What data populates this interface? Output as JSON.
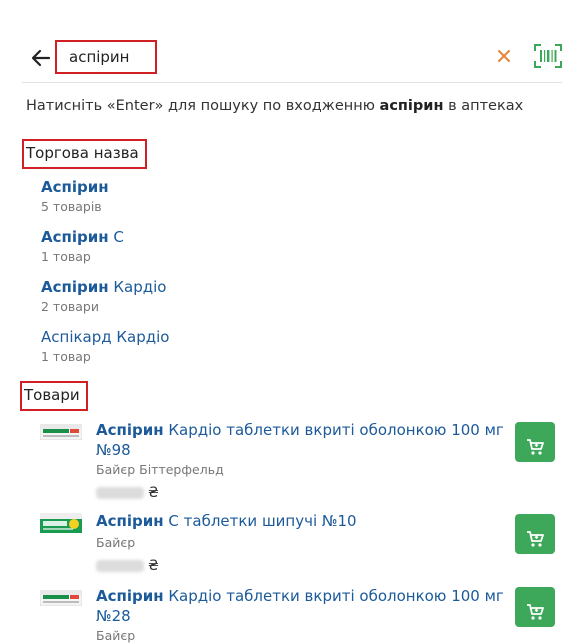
{
  "search": {
    "value": "аспірин",
    "clear_icon": "close-icon",
    "barcode_icon": "barcode-scan-icon",
    "back_icon": "arrow-left-icon"
  },
  "hint": {
    "prefix": "Натисніть «Enter» для пошуку по входженню ",
    "term": "аспірин",
    "suffix": " в аптеках"
  },
  "brands": {
    "title": "Торгова назва",
    "items": [
      {
        "bold": "Аспірин",
        "rest": "",
        "count": "5 товарів"
      },
      {
        "bold": "Аспірин",
        "rest": " С",
        "count": "1 товар"
      },
      {
        "bold": "Аспірин",
        "rest": " Кардіо",
        "count": "2 товари"
      },
      {
        "bold": "",
        "rest": "Аспікард Кардіо",
        "count": "1 товар"
      }
    ]
  },
  "products": {
    "title": "Товари",
    "currency": "₴",
    "items": [
      {
        "bold": "Аспірин",
        "rest": " Кардіо таблетки вкриті оболонкою 100 мг №98",
        "maker": "Байєр Біттерфельд"
      },
      {
        "bold": "Аспірин",
        "rest": " С таблетки шипучі №10",
        "maker": "Байєр"
      },
      {
        "bold": "Аспірин",
        "rest": " Кардіо таблетки вкриті оболонкою 100 мг №28",
        "maker": "Байєр"
      }
    ]
  },
  "colors": {
    "accent_blue": "#1c5a99",
    "cart_green": "#3ea85a",
    "highlight_red": "#d11f26",
    "clear_orange": "#e8833a"
  }
}
